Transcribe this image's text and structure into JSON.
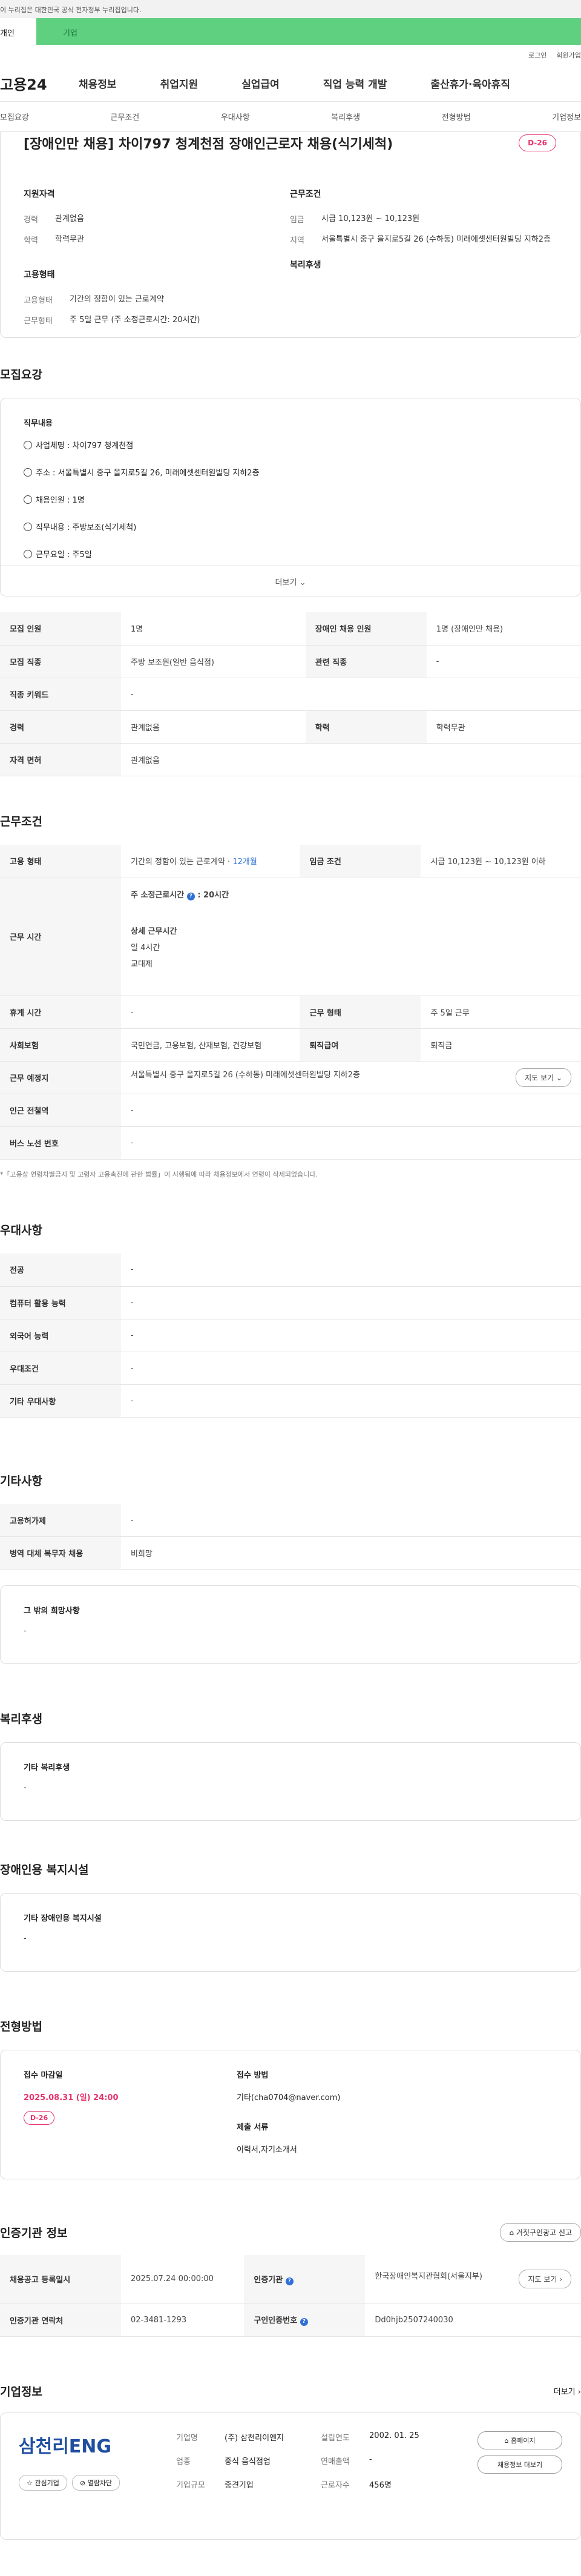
{
  "gov_banner": "이 누리집은 대한민국 공식 전자정부 누리집입니다.",
  "tabs": [
    "개인",
    "기업"
  ],
  "util": [
    "로그인",
    "회원가입"
  ],
  "logo": "고용24",
  "gnb": [
    "채용정보",
    "취업지원",
    "실업급여",
    "직업 능력 개발",
    "출산휴가·육아휴직"
  ],
  "anchors": [
    "모집요강",
    "근무조건",
    "우대사항",
    "복리후생",
    "전형방법",
    "기업정보"
  ],
  "summary": {
    "title": "[장애인만 채용] 차이797 청계천점 장애인근로자 채용(식기세척)",
    "dday": "D-26",
    "qual_title": "지원자격",
    "qual": [
      {
        "k": "경력",
        "v": "관계없음"
      },
      {
        "k": "학력",
        "v": "학력무관"
      }
    ],
    "emp_title": "고용형태",
    "emp": [
      {
        "k": "고용형태",
        "v": "기간의 정함이 있는 근로계약"
      },
      {
        "k": "근무형태",
        "v": "주 5일 근무 (주 소정근로시간: 20시간)"
      }
    ],
    "cond_title": "근무조건",
    "cond": [
      {
        "k": "임금",
        "v": "시급 10,123원 ~ 10,123원"
      },
      {
        "k": "지역",
        "v": "서울특별시 중구 을지로5길 26 (수하동) 미래에셋센터원빌딩 지하2층"
      }
    ],
    "welfare_title": "복리후생"
  },
  "recruit": {
    "title": "모집요강",
    "box_title": "직무내용",
    "items": [
      "사업체명 : 차이797 청계천점",
      "주소 : 서울특별시 중구 을지로5길 26, 미래에셋센터원빌딩 지하2층",
      "채용인원 : 1명",
      "직무내용 : 주방보조(식기세척)",
      "근무요일 : 주5일"
    ],
    "more": "더보기",
    "rows": [
      [
        "모집 인원",
        "1명",
        "장애인 채용 인원",
        "1명 (장애인만 채용)"
      ],
      [
        "모집 직종",
        "주방 보조원(일반 음식점)",
        "관련 직종",
        "-"
      ],
      [
        "직종 키워드",
        "-",
        "",
        ""
      ],
      [
        "경력",
        "관계없음",
        "학력",
        "학력무관"
      ],
      [
        "자격 면허",
        "관계없음",
        "",
        ""
      ]
    ]
  },
  "work": {
    "title": "근무조건",
    "type_k": "고용 형태",
    "type_v": "기간의 정함이 있는 근로계약 · ",
    "type_v2": "12개월",
    "wage_k": "임금 조건",
    "wage_v": "시급 10,123원 ~ 10,123원 이하",
    "time_k": "근무 시간",
    "time_main": "주 소정근로시간",
    "time_main_v": ": 20시간",
    "time_detail_title": "상세 근무시간",
    "time_detail": "일 4시간",
    "time_shift": "교대제",
    "rows": [
      [
        "휴게 시간",
        "-",
        "근무 형태",
        "주 5일 근무"
      ],
      [
        "사회보험",
        "국민연금, 고용보험, 산재보험, 건강보험",
        "퇴직급여",
        "퇴직금"
      ]
    ],
    "place_k": "근무 예정지",
    "place_v": "서울특별시 중구 을지로5길 26 (수하동) 미래에셋센터원빌딩 지하2층",
    "map_btn": "지도 보기",
    "station_k": "인근 전철역",
    "station_v": "-",
    "bus_k": "버스 노선 번호",
    "bus_v": "-",
    "note": "*「고용상 연령차별금지 및 고령자 고용촉진에 관한 법률」이 시행됨에 따라 채용정보에서 연령이 삭제되었습니다."
  },
  "pref": {
    "title": "우대사항",
    "rows": [
      [
        "전공",
        "-"
      ],
      [
        "컴퓨터 활용 능력",
        "-"
      ],
      [
        "외국어 능력",
        "-"
      ],
      [
        "우대조건",
        "-"
      ],
      [
        "기타 우대사항",
        "-"
      ]
    ]
  },
  "etc": {
    "title": "기타사항",
    "rows": [
      [
        "고용허가제",
        "-"
      ],
      [
        "병역 대체 복무자 채용",
        "비희망"
      ]
    ],
    "box_title": "그 밖의 희망사항",
    "box_v": "-"
  },
  "welfare": {
    "title": "복리후생",
    "box_title": "기타 복리후생",
    "box_v": "-"
  },
  "facility": {
    "title": "장애인용 복지시설",
    "box_title": "기타 장애인용 복지시설",
    "box_v": "-"
  },
  "screen": {
    "title": "전형방법",
    "deadline_k": "접수 마감일",
    "deadline_v": "2025.08.31 (일) 24:00",
    "dday": "D-26",
    "method_k": "접수 방법",
    "method_v": "기타(cha0704@naver.com)",
    "docs_k": "제출 서류",
    "docs_v": "이력서,자기소개서"
  },
  "agency": {
    "title": "인증기관 정보",
    "report_btn": "거짓구인광고 신고",
    "reg_k": "채용공고 등록일시",
    "reg_v": "2025.07.24 00:00:00",
    "org_k": "인증기관",
    "org_v": "한국장애인복지관협회(서울지부)",
    "map_btn": "지도 보기",
    "contact_k": "인증기관 연락처",
    "contact_v": "02-3481-1293",
    "code_k": "구인인증번호",
    "code_v": "Dd0hjb2507240030"
  },
  "company": {
    "title": "기업정보",
    "more": "더보기",
    "logo_text": "삼천리ENG",
    "btn_like": "관심기업",
    "btn_block": "열람차단",
    "name_k": "기업명",
    "name_v": "(주) 삼천리이엔지",
    "industry_k": "업종",
    "industry_v": "중식 음식점업",
    "size_k": "기업규모",
    "size_v": "중견기업",
    "est_k": "설립연도",
    "est_v": "2002. 01. 25",
    "sales_k": "연매출액",
    "sales_v": "-",
    "staff_k": "근로자수",
    "staff_v": "456명",
    "btn_home": "홈페이지",
    "btn_jobs": "채용정보 더보기"
  }
}
